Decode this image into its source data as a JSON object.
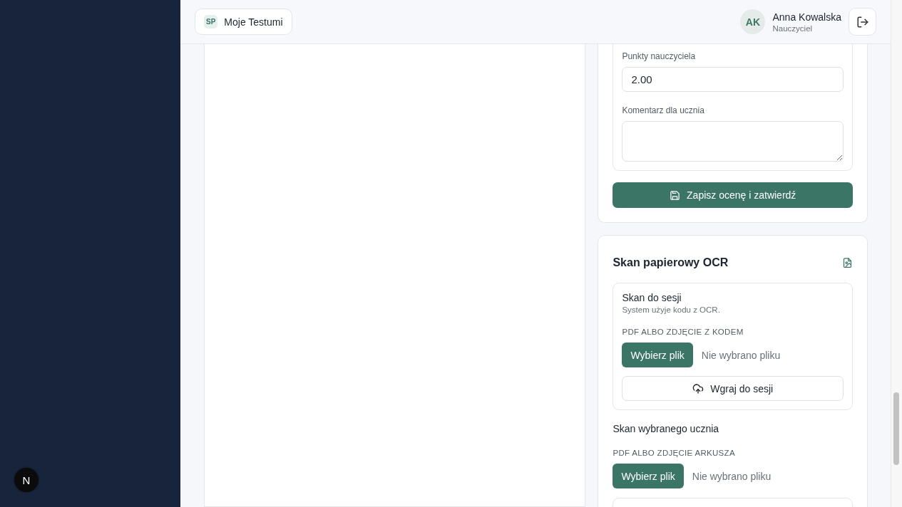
{
  "dev_badge": {
    "label": "N"
  },
  "header": {
    "brand": {
      "initials": "SP",
      "name": "Moje Testumi"
    },
    "user": {
      "initials": "AK",
      "name": "Anna Kowalska",
      "role": "Nauczyciel"
    }
  },
  "grading_card": {
    "points_label": "Punkty nauczyciela",
    "points_value": "2.00",
    "comment_label": "Komentarz dla ucznia",
    "save_button": "Zapisz ocenę i zatwierdź"
  },
  "ocr_card": {
    "title": "Skan papierowy OCR",
    "session_scan": {
      "title": "Skan do sesji",
      "subtitle": "System użyje kodu z OCR.",
      "file_label": "PDF ALBO ZDJĘCIE Z KODEM",
      "choose_button": "Wybierz plik",
      "file_status": "Nie wybrano pliku",
      "upload_button": "Wgraj do sesji"
    },
    "student_scan": {
      "title": "Skan wybranego ucznia",
      "file_label": "PDF ALBO ZDJĘCIE ARKUSZA",
      "choose_button": "Wybierz plik",
      "file_status": "Nie wybrano pliku"
    }
  }
}
